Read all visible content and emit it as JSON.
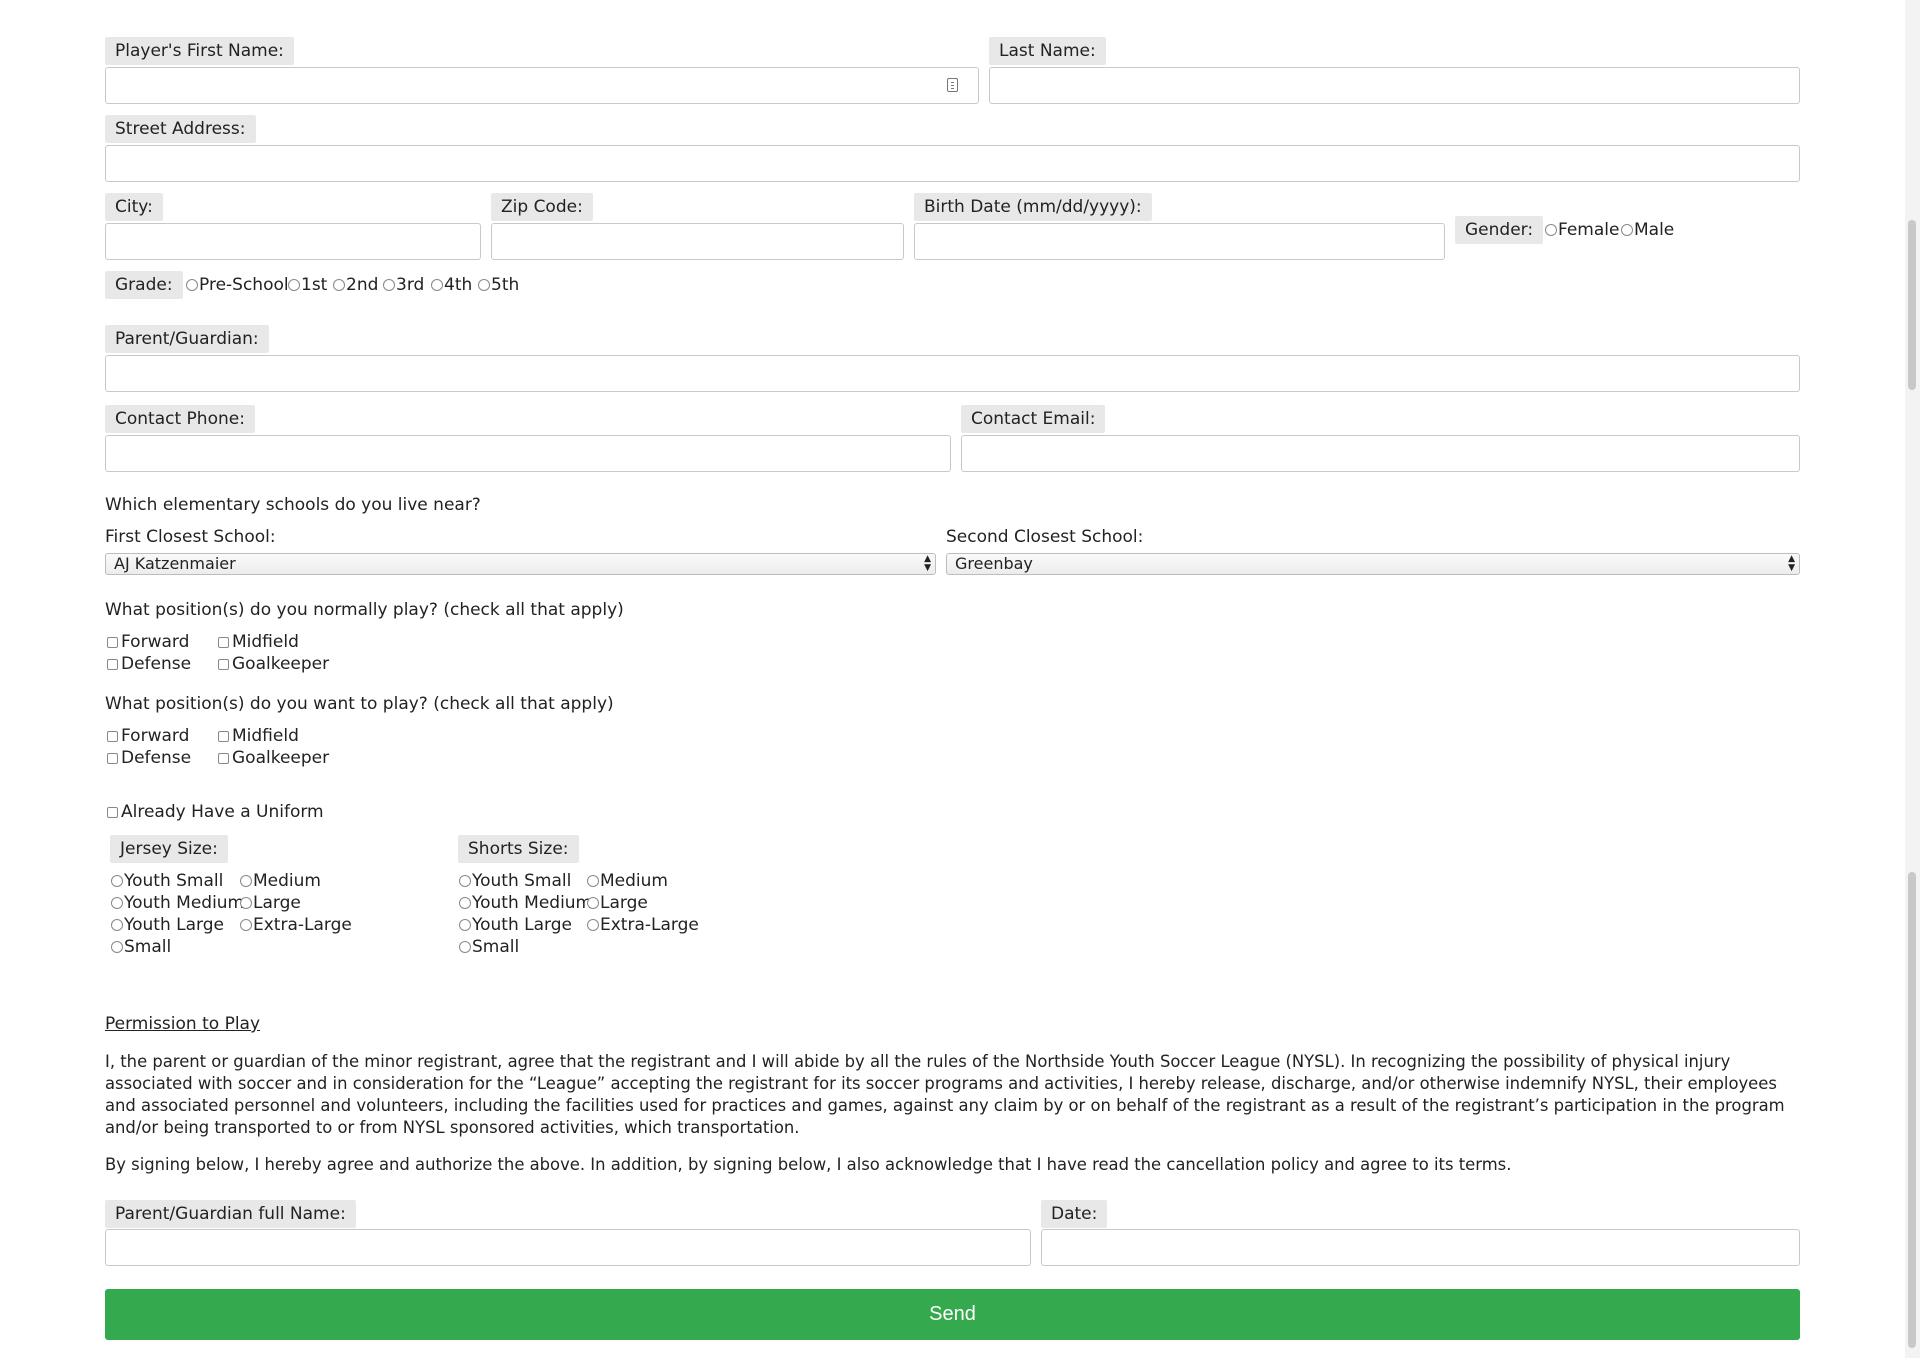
{
  "player": {
    "first_name_label": "Player's First Name:",
    "first_name_value": "",
    "last_name_label": "Last Name:",
    "last_name_value": "",
    "street_label": "Street Address:",
    "street_value": "",
    "city_label": "City:",
    "city_value": "",
    "zip_label": "Zip Code:",
    "zip_value": "",
    "birth_label": "Birth Date (mm/dd/yyyy):",
    "birth_value": "",
    "gender_label": "Gender:",
    "gender_options": [
      "Female",
      "Male"
    ],
    "grade_label": "Grade:",
    "grade_options": [
      "Pre-School",
      "1st",
      "2nd",
      "3rd",
      "4th",
      "5th"
    ]
  },
  "guardian": {
    "label": "Parent/Guardian:",
    "value": "",
    "phone_label": "Contact Phone:",
    "phone_value": "",
    "email_label": "Contact Email:",
    "email_value": ""
  },
  "schools": {
    "question": "Which elementary schools do you live near?",
    "first_label": "First Closest School:",
    "first_selected": "AJ Katzenmaier",
    "second_label": "Second Closest School:",
    "second_selected": "Greenbay"
  },
  "positions": {
    "normal_question": "What position(s) do you normally play? (check all that apply)",
    "want_question": "What position(s) do you want to play? (check all that apply)",
    "options": [
      "Forward",
      "Midfield",
      "Defense",
      "Goalkeeper"
    ]
  },
  "uniform": {
    "already_label": "Already Have a Uniform",
    "jersey_label": "Jersey Size:",
    "shorts_label": "Shorts Size:",
    "sizes": [
      "Youth Small",
      "Medium",
      "Youth Medium",
      "Large",
      "Youth Large",
      "Extra-Large",
      "Small"
    ]
  },
  "permission": {
    "heading": "Permission to Play",
    "body": "I, the parent or guardian of the minor registrant, agree that the registrant and I will abide by all the rules of the Northside Youth Soccer League (NYSL). In recognizing the possibility of physical injury associated with soccer and in consideration for the “League” accepting the registrant for its soccer programs and activities, I hereby release, discharge, and/or otherwise indemnify NYSL, their employees and associated personnel and volunteers, including the facilities used for practices and games, against any claim by or on behalf of the registrant as a result of the registrant’s participation in the program and/or being transported to or from NYSL sponsored activities, which transportation.",
    "agree": "By signing below, I hereby agree and authorize the above. In addition, by signing below, I also acknowledge that I have read the cancellation policy and agree to its terms."
  },
  "signature": {
    "name_label": "Parent/Guardian full Name:",
    "name_value": "",
    "date_label": "Date:",
    "date_value": ""
  },
  "submit_label": "Send",
  "colors": {
    "send_button": "#34a94d",
    "label_bg": "#e8e8e8"
  }
}
